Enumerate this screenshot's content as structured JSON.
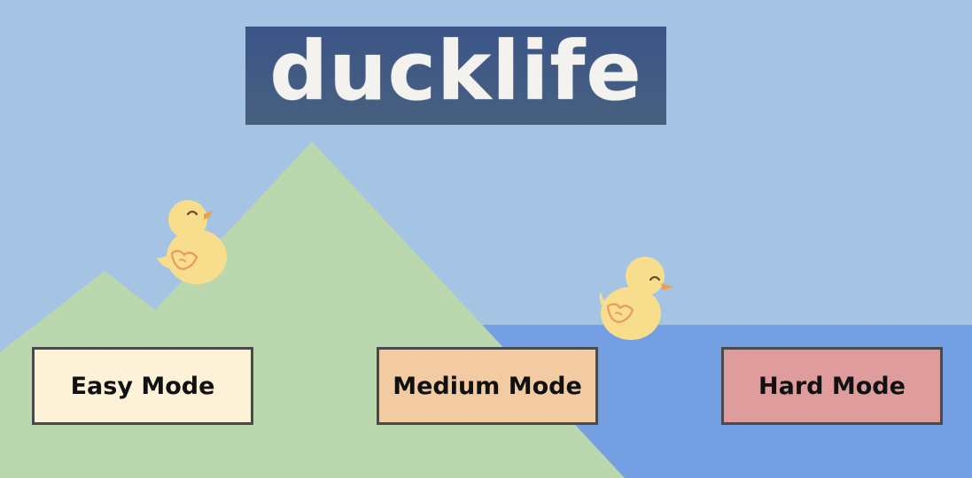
{
  "logo": {
    "text": "ducklife"
  },
  "modes": {
    "easy_label": "Easy Mode",
    "medium_label": "Medium Mode",
    "hard_label": "Hard Mode"
  },
  "colors": {
    "sky": "#a5c4e4",
    "mountain": "#bad7ae",
    "water": "#749fe3",
    "logo_banner": "#3f5885",
    "easy_button": "#fdf2d7",
    "medium_button": "#f2cba2",
    "hard_button": "#df9c9c",
    "duck_body": "#f8de8c",
    "duck_beak": "#f0a04b"
  },
  "icons": [
    "duck-icon-left",
    "duck-icon-right"
  ]
}
